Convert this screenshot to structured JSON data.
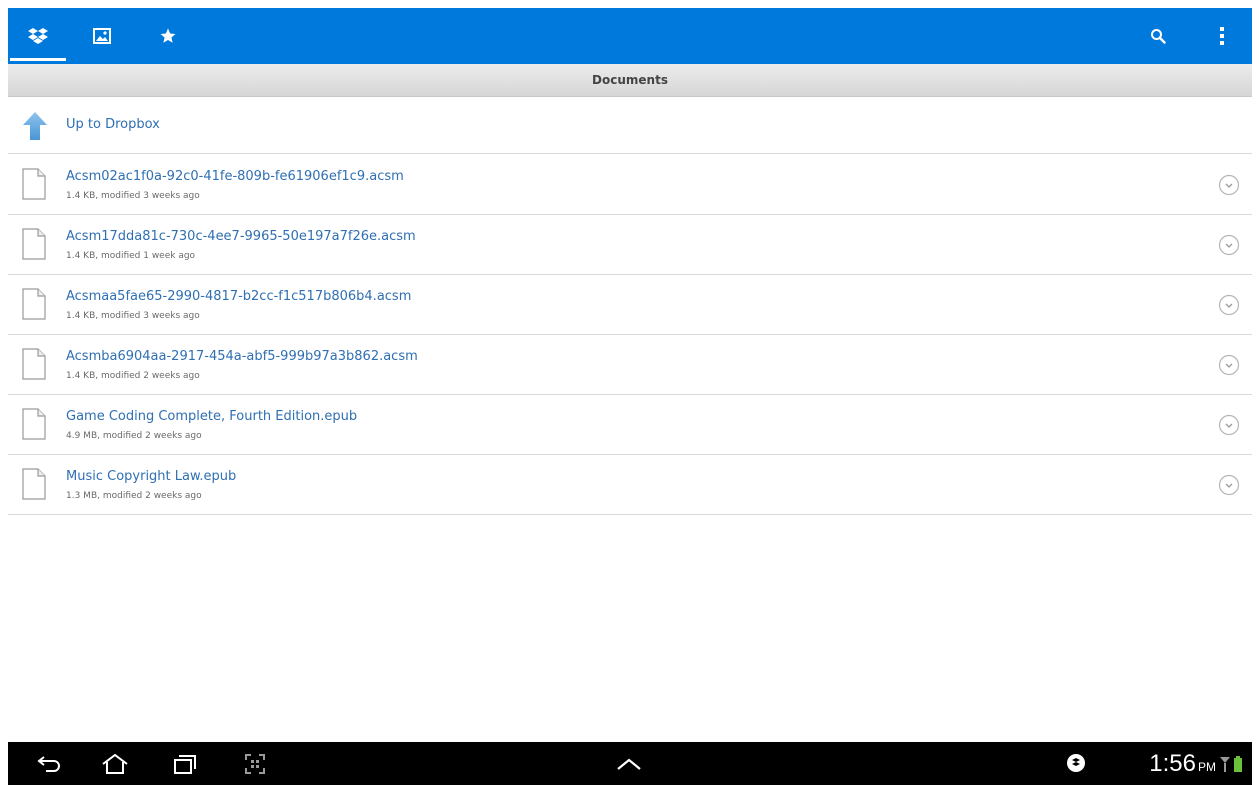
{
  "toolbar": {
    "tabs": [
      {
        "icon": "dropbox-icon",
        "active": true
      },
      {
        "icon": "photos-icon",
        "active": false
      },
      {
        "icon": "favorites-star-icon",
        "active": false
      }
    ],
    "actions": [
      {
        "icon": "search-icon"
      },
      {
        "icon": "overflow-menu-icon"
      }
    ],
    "accent_color": "#0079dc"
  },
  "folder": {
    "title": "Documents",
    "up_label": "Up to Dropbox"
  },
  "files": [
    {
      "name": "Acsm02ac1f0a-92c0-41fe-809b-fe61906ef1c9.acsm",
      "meta": "1.4 KB, modified 3 weeks ago"
    },
    {
      "name": "Acsm17dda81c-730c-4ee7-9965-50e197a7f26e.acsm",
      "meta": "1.4 KB, modified 1 week ago"
    },
    {
      "name": "Acsmaa5fae65-2990-4817-b2cc-f1c517b806b4.acsm",
      "meta": "1.4 KB, modified 3 weeks ago"
    },
    {
      "name": "Acsmba6904aa-2917-454a-abf5-999b97a3b862.acsm",
      "meta": "1.4 KB, modified 2 weeks ago"
    },
    {
      "name": "Game Coding Complete, Fourth Edition.epub",
      "meta": "4.9 MB, modified 2 weeks ago"
    },
    {
      "name": "Music Copyright Law.epub",
      "meta": "1.3 MB, modified 2 weeks ago"
    }
  ],
  "system_bar": {
    "time": "1:56",
    "ampm": "PM"
  }
}
